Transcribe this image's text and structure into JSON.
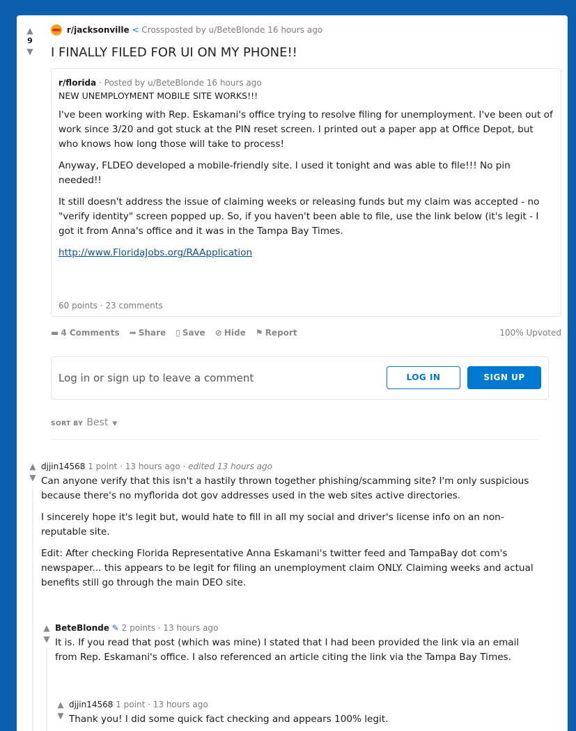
{
  "post": {
    "score": "9",
    "subreddit": "r/jacksonville",
    "crosspost_info": "Crossposted by u/BeteBlonde 16 hours ago",
    "title": "I FINALLY FILED FOR UI ON MY PHONE!!",
    "upvoted": "100% Upvoted"
  },
  "crosspost": {
    "subreddit": "r/florida",
    "posted_by": "· Posted by u/BeteBlonde 16 hours ago",
    "title": "NEW UNEMPLOYMENT MOBILE SITE WORKS!!!",
    "paragraphs": [
      "I've been working with Rep. Eskamani's office trying to resolve filing for unemployment. I've been out of work since 3/20 and got stuck at the PIN reset screen. I printed out a paper app at Office Depot, but who knows how long those will take to process!",
      "Anyway, FLDEO developed a mobile-friendly site. I used it tonight and was able to file!!! No pin needed!!",
      "It still doesn't address the issue of claiming weeks or releasing funds but my claim was accepted - no \"verify identity\" screen popped up. So, if you haven't been able to file, use the link below (it's legit - I got it from Anna's office and it was in the Tampa Bay Times."
    ],
    "link": "http://www.FloridaJobs.org/RAApplication",
    "stats": "60 points · 23 comments"
  },
  "actions": {
    "comments": "4 Comments",
    "share": "Share",
    "save": "Save",
    "hide": "Hide",
    "report": "Report"
  },
  "login": {
    "prompt": "Log in or sign up to leave a comment",
    "login_label": "LOG IN",
    "signup_label": "SIGN UP"
  },
  "sort": {
    "label": "SORT BY",
    "value": "Best"
  },
  "comments": [
    {
      "author": "djjin14568",
      "meta": "1 point · 13 hours ago ·",
      "edited": "edited 13 hours ago",
      "paragraphs": [
        "Can anyone verify that this isn't a hastily thrown together phishing/scamming site? I'm only suspicious because there's no myflorida dot gov addresses used in the web sites active directories.",
        "I sincerely hope it's legit but, would hate to fill in all my social and driver's license info on an non-reputable site.",
        "Edit: After checking Florida Representative Anna Eskamani's twitter feed and TampaBay dot com's newspaper... this appears to be legit for filing an unemployment claim ONLY. Claiming weeks and actual benefits still go through the main DEO site."
      ]
    },
    {
      "author": "BeteBlonde",
      "meta": "2 points · 13 hours ago",
      "paragraphs": [
        "It is. If you read that post (which was mine) I stated that I had been provided the link via an email from Rep. Eskamani's office. I also referenced an article citing the link via the Tampa Bay Times."
      ]
    },
    {
      "author": "djjin14568",
      "meta": "1 point · 13 hours ago",
      "paragraphs": [
        "Thank you! I did some quick fact checking and appears 100% legit."
      ]
    }
  ],
  "colors": {
    "background": "#0b5fae",
    "accent": "#0079d3",
    "link": "#0b4f97"
  }
}
